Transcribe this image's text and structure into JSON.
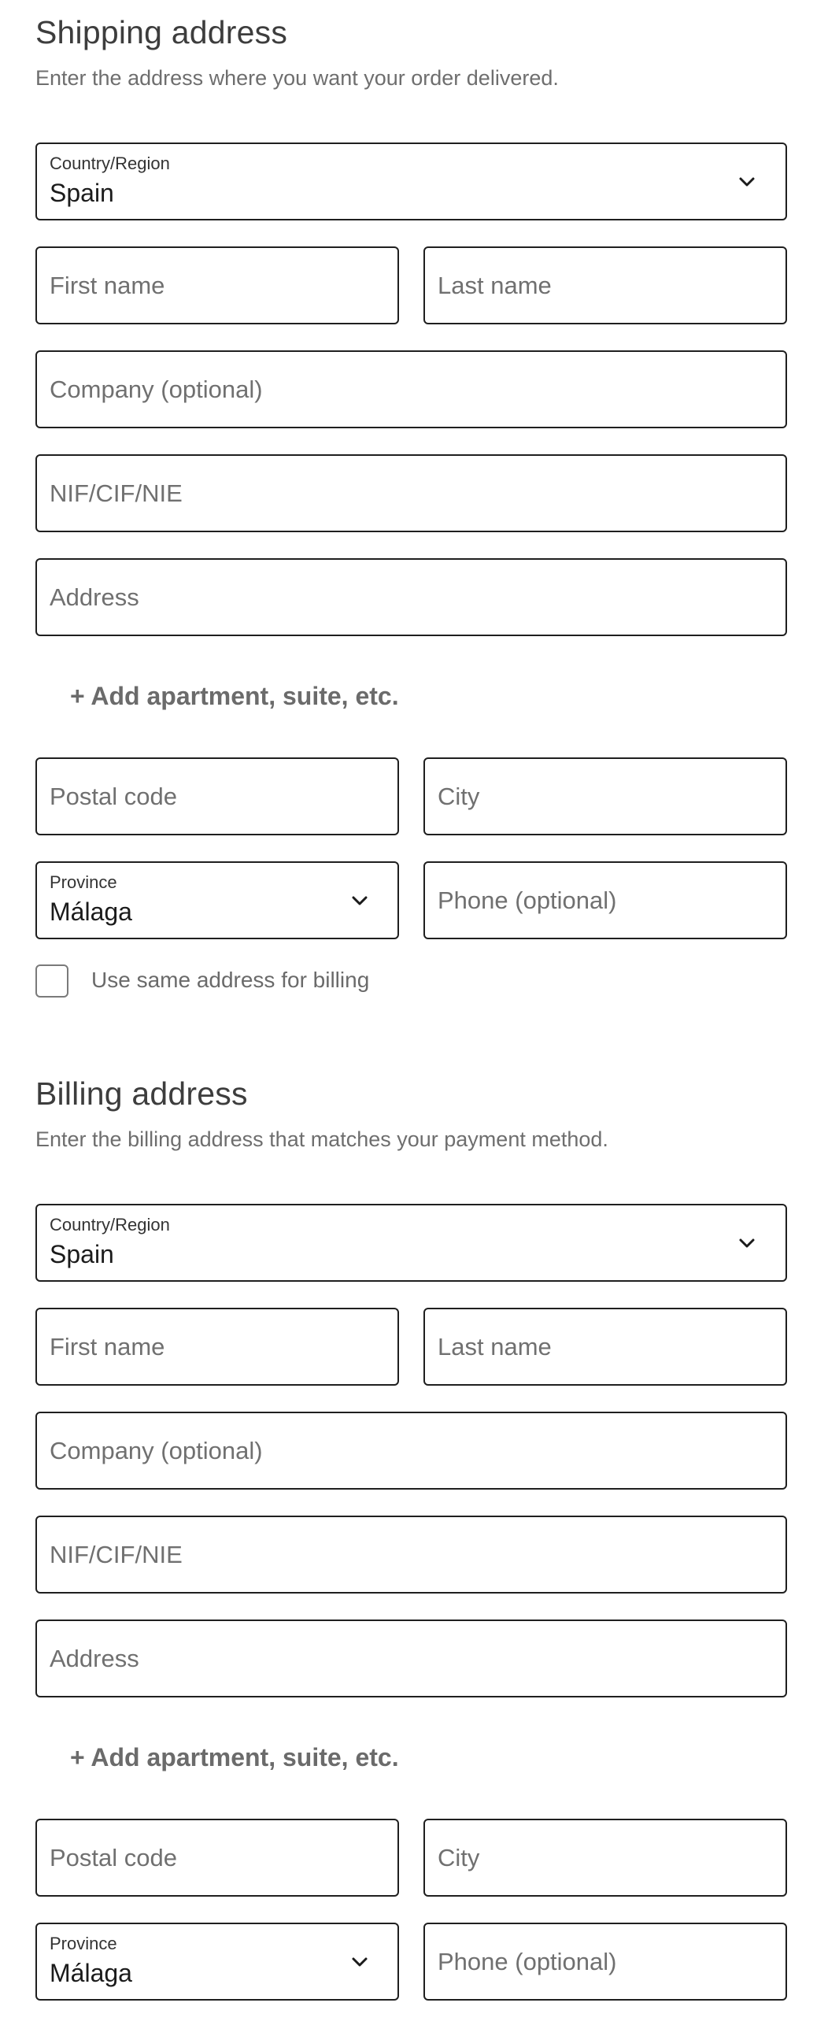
{
  "shipping": {
    "title": "Shipping address",
    "subtitle": "Enter the address where you want your order delivered.",
    "country": {
      "label": "Country/Region",
      "value": "Spain",
      "icon": "chevron-down-icon"
    },
    "first_name": {
      "placeholder": "First name"
    },
    "last_name": {
      "placeholder": "Last name"
    },
    "company": {
      "placeholder": "Company (optional)"
    },
    "tax_id": {
      "placeholder": "NIF/CIF/NIE"
    },
    "address": {
      "placeholder": "Address"
    },
    "add_apartment": "+ Add apartment, suite, etc.",
    "postal_code": {
      "placeholder": "Postal code"
    },
    "city": {
      "placeholder": "City"
    },
    "province": {
      "label": "Province",
      "value": "Málaga",
      "icon": "chevron-down-icon"
    },
    "phone": {
      "placeholder": "Phone (optional)"
    },
    "same_billing": {
      "label": "Use same address for billing",
      "checked": false
    }
  },
  "billing": {
    "title": "Billing address",
    "subtitle": "Enter the billing address that matches your payment method.",
    "country": {
      "label": "Country/Region",
      "value": "Spain",
      "icon": "chevron-down-icon"
    },
    "first_name": {
      "placeholder": "First name"
    },
    "last_name": {
      "placeholder": "Last name"
    },
    "company": {
      "placeholder": "Company (optional)"
    },
    "tax_id": {
      "placeholder": "NIF/CIF/NIE"
    },
    "address": {
      "placeholder": "Address"
    },
    "add_apartment": "+ Add apartment, suite, etc.",
    "postal_code": {
      "placeholder": "Postal code"
    },
    "city": {
      "placeholder": "City"
    },
    "province": {
      "label": "Province",
      "value": "Málaga",
      "icon": "chevron-down-icon"
    },
    "phone": {
      "placeholder": "Phone (optional)"
    }
  },
  "colors": {
    "border": "#1f1f1f",
    "placeholder": "#707070",
    "muted_text": "#6e6e6e"
  }
}
